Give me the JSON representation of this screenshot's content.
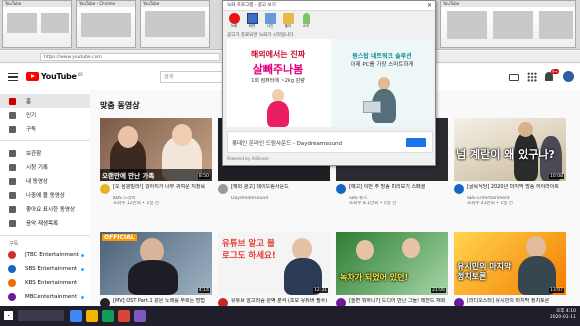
{
  "browser": {
    "url": "https://www.youtube.com",
    "thumbnail_titles": [
      "YouTube",
      "YouTube - Chrome",
      "YouTube",
      "YouTube"
    ]
  },
  "header": {
    "logo_text": "YouTube",
    "logo_region": "KR",
    "search_placeholder": "검색",
    "notification_count": "9+"
  },
  "sidebar": {
    "items": [
      {
        "label": "홈",
        "icon": "home-icon",
        "active": true
      },
      {
        "label": "인기",
        "icon": "trending-icon"
      },
      {
        "label": "구독",
        "icon": "subscriptions-icon"
      },
      {
        "label": "보관함",
        "icon": "library-icon"
      },
      {
        "label": "시청 기록",
        "icon": "history-icon"
      },
      {
        "label": "내 동영상",
        "icon": "my-videos-icon"
      },
      {
        "label": "나중에 볼 동영상",
        "icon": "watch-later-icon"
      },
      {
        "label": "좋아요 표시한 동영상",
        "icon": "liked-icon"
      },
      {
        "label": "음악 재생목록",
        "icon": "playlist-icon"
      }
    ],
    "subs_heading": "구독",
    "subscriptions": [
      {
        "label": "JTBC Entertainment",
        "color": "#d32f2f",
        "live": true
      },
      {
        "label": "SBS Entertainment",
        "color": "#1565c0",
        "live": true
      },
      {
        "label": "KBS Entertainment",
        "color": "#ef6c00",
        "live": false
      },
      {
        "label": "MBCentertainment",
        "color": "#6a1b9a",
        "live": true
      }
    ]
  },
  "main": {
    "section_title": "맞춤 동영상",
    "videos": [
      {
        "title": "[오 삼광빌라!] 강아지가 너무 귀여운 지창욱",
        "channel": "KBS 드라마",
        "meta": "조회수 12만회 • 1일 전",
        "duration": "8:50",
        "caption": "오랜만에 만난 가족",
        "theme": "drama"
      },
      {
        "title": "[해외 광고] 데이드림사운드",
        "channel": "Daydreamsound",
        "meta": "광고",
        "duration": "",
        "caption": "",
        "theme": "hidden"
      },
      {
        "title": "[예고] 이번 주 방송 미리보기 스페셜",
        "channel": "SBS 뉴스",
        "meta": "조회수 8.1만회 • 5일 전",
        "duration": "",
        "caption": "",
        "theme": "hidden"
      },
      {
        "title": "[골목식당] 2020년 마지막 방송 하이라이트",
        "channel": "SBS Entertainment",
        "meta": "조회수 43만회 • 1일 전",
        "duration": "10:08",
        "caption": "",
        "big": "넘 계란이 왜 있구나?",
        "theme": "variety"
      },
      {
        "title": "[MV] OST Part.1 같은 노래를 부르는 방법",
        "channel": "1theK (원더케이)",
        "meta": "조회수 32만회 • 2주 전",
        "duration": "4:14",
        "caption": "",
        "badge": "OFFICIAL",
        "theme": "mv"
      },
      {
        "title": "유튜브 알고리즘 완벽 분석 (초보 유튜버 필수)",
        "channel": "유튜브 스튜디오",
        "meta": "조회수 5.3만회 • 3일 전",
        "duration": "12:31",
        "big": "유튜브 알고 블로그도 하세요!",
        "theme": "talk"
      },
      {
        "title": "[놀면 뭐하니?] 드디어 만난 그들! 레전드 재회",
        "channel": "MBCentertainment",
        "meta": "조회수 61만회 • 4일 전",
        "duration": "21:06",
        "big": "녹차가 되었어 있던!",
        "theme": "variety2"
      },
      {
        "title": "[라디오스타] 유시민의 마지막 정치토론",
        "channel": "MBCentertainment",
        "meta": "조회수 98만회 • 1주 전",
        "duration": "13:07",
        "big": "유시민의 마지막 정치토론",
        "theme": "talk2"
      }
    ]
  },
  "ad_window": {
    "title": "녹화 프로그램 - 광고 보기",
    "toolbar": [
      "녹화",
      "화면",
      "사진",
      "폴더",
      "소리"
    ],
    "subline": "광고가 종료되면 녹화가 시작됩니다.",
    "banner_left_line1": "해외에서는 진짜",
    "banner_left_line2": "살빼주나봄",
    "banner_left_line3": "1회 컴퓨터에 ~2kg 감량",
    "banner_right_line1": "원스탑 네트워크 솔루션",
    "banner_right_line2": "이제 PC를 가장 스마트하게",
    "bottom_text": "롯데인 온라인 드림사운드 - Daydreamsound",
    "status": "Powered by AdSense"
  },
  "taskbar": {
    "time": "오후 4:10",
    "date": "2020-01-11"
  }
}
